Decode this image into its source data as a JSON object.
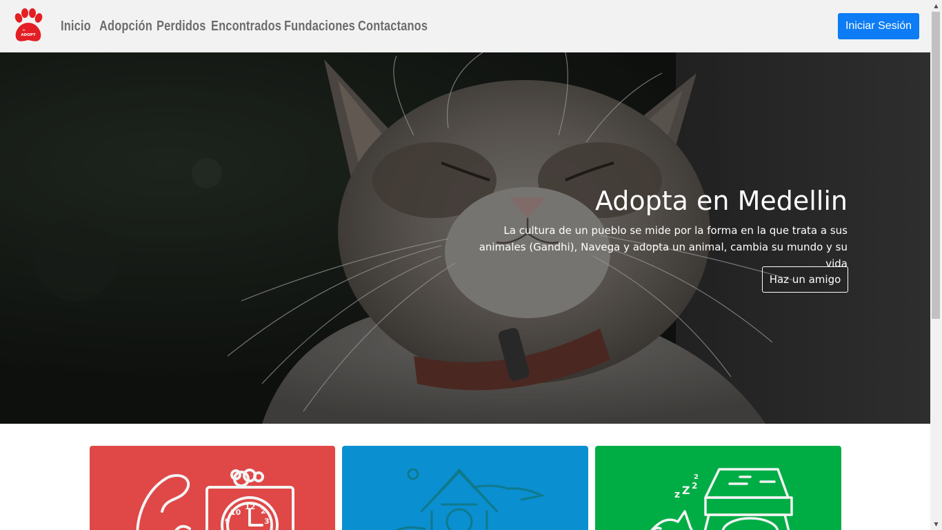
{
  "brand": {
    "logo_text": "ADOPT",
    "logo_color": "#e31e24"
  },
  "nav": {
    "links": [
      "Inicio",
      "Adopción",
      "Perdidos",
      "Encontrados",
      "Fundaciones",
      "Contactanos"
    ],
    "login_label": "Iniciar Sesión",
    "login_color": "#0d7cf5"
  },
  "hero": {
    "title": "Adopta en Medellin",
    "text": "La cultura de un pueblo se mide por la forma en la que trata a sus animales (Gandhi), Navega y adopta un animal, cambia su mundo y su vida",
    "button_label": "Haz un amigo",
    "image": "cat-photo"
  },
  "cards": [
    {
      "color": "#e04747",
      "icon": "cat-clock-illustration"
    },
    {
      "color": "#0a8fd0",
      "icon": "dog-house-illustration"
    },
    {
      "color": "#00ad45",
      "icon": "sleeping-cat-box-illustration"
    }
  ]
}
